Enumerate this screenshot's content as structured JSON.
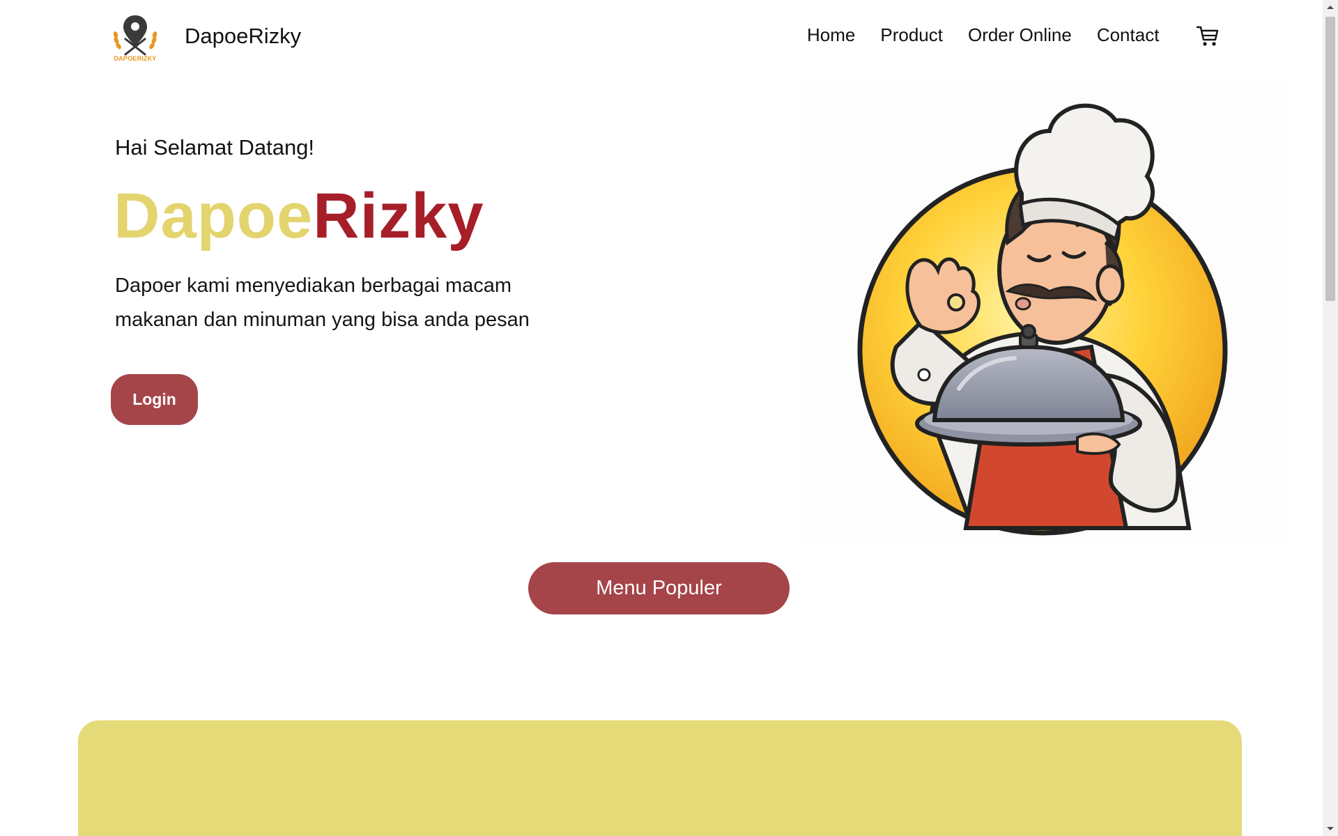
{
  "nav": {
    "logo_text": "DAPOERIZKY",
    "brand": "DapoeRizky",
    "links": [
      "Home",
      "Product",
      "Order Online",
      "Contact"
    ],
    "cart_icon": "shopping-cart-icon"
  },
  "hero": {
    "greeting": "Hai Selamat Datang!",
    "title_part1": "Dapoe",
    "title_part2": "Rizky",
    "description": "Dapoer kami menyediakan berbagai macam makanan dan minuman yang bisa anda pesan",
    "login_label": "Login",
    "illustration": "chef-illustration"
  },
  "menu": {
    "button_label": "Menu Populer"
  },
  "colors": {
    "brand_yellow": "#e3d46e",
    "brand_red": "#a61e28",
    "button_red": "#a54549",
    "panel_yellow": "#e4da78"
  }
}
